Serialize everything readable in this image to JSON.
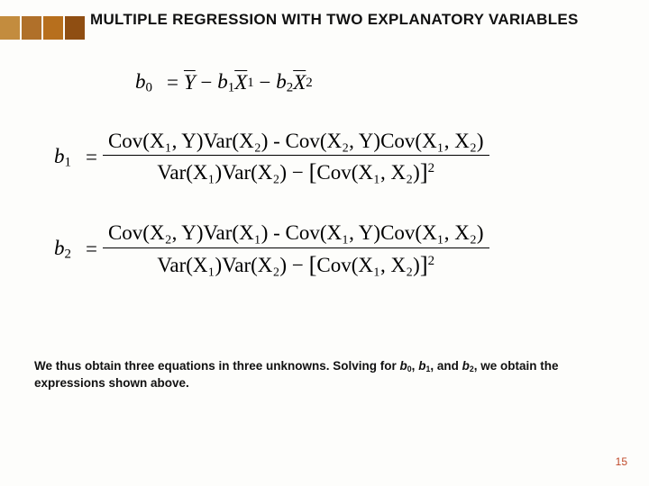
{
  "title": "MULTIPLE REGRESSION WITH TWO EXPLANATORY VARIABLES",
  "eq0": {
    "lhs_sym": "b",
    "lhs_sub": "0",
    "t1": "Y",
    "t2_coef": "b",
    "t2_coef_sub": "1",
    "t2_var": "X",
    "t2_var_sub": "1",
    "t3_coef": "b",
    "t3_coef_sub": "2",
    "t3_var": "X",
    "t3_var_sub": "2"
  },
  "eq1": {
    "lhs_sym": "b",
    "lhs_sub": "1",
    "num": "Cov(X₁, Y)Var(X₂) - Cov(X₂, Y)Cov(X₁, X₂)",
    "den_left": "Var(X₁)Var(X₂) − ",
    "den_inner": "Cov(X₁, X₂)",
    "den_pow": "2"
  },
  "eq2": {
    "lhs_sym": "b",
    "lhs_sub": "2",
    "num": "Cov(X₂, Y)Var(X₁) - Cov(X₁, Y)Cov(X₁, X₂)",
    "den_left": "Var(X₁)Var(X₂) − ",
    "den_inner": "Cov(X₁, X₂)",
    "den_pow": "2"
  },
  "caption": {
    "pre": "We thus obtain three equations in three unknowns.  Solving for ",
    "b0": "b",
    "b0s": "0",
    "sep1": ", ",
    "b1": "b",
    "b1s": "1",
    "sep2": ", and ",
    "b2": "b",
    "b2s": "2",
    "post": ", we obtain the expressions shown above."
  },
  "page_number": "15"
}
